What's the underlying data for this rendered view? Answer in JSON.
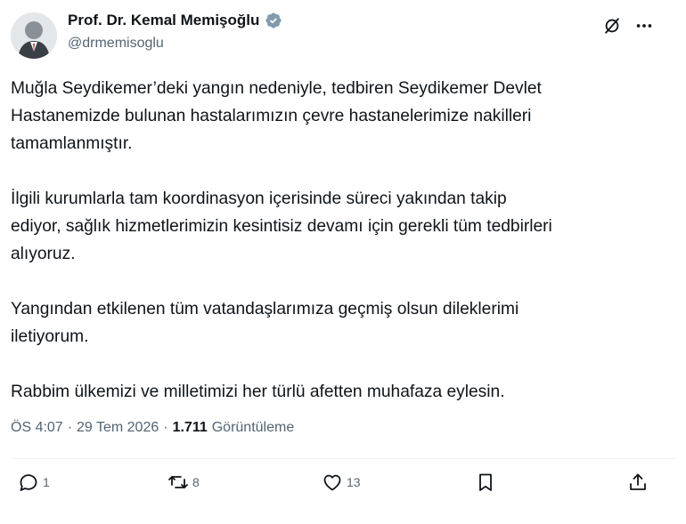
{
  "author": {
    "display_name": "Prof. Dr. Kemal Memişoğlu",
    "handle": "@drmemisoglu",
    "avatar_icon": "avatar-photo",
    "verified_icon": "verified-badge-icon"
  },
  "top_actions": {
    "grok_icon": "grok-icon",
    "more_icon": "more-icon"
  },
  "tweet": {
    "paragraphs": [
      "Muğla Seydikemer’deki yangın nedeniyle, tedbiren Seydikemer Devlet\nHastanemizde bulunan hastalarımızın çevre hastanelerimize nakilleri\ntamamlanmıştır.",
      "İlgili kurumlarla tam koordinasyon içerisinde süreci yakından takip\nediyor, sağlık hizmetlerimizin kesintisiz devamı için gerekli tüm tedbirleri\nalıyoruz.",
      "Yangından etkilenen tüm vatandaşlarımıza geçmiş olsun dileklerimi\niletiyorum.",
      "Rabbim ülkemizi ve milletimizi her türlü afetten muhafaza eylesin."
    ]
  },
  "meta": {
    "time": "ÖS 4:07",
    "separator": "·",
    "date": "29 Tem 2026",
    "views_count": "1.711",
    "views_label": "Görüntüleme"
  },
  "actions": {
    "reply_count": "1",
    "retweet_count": "8",
    "like_count": "13",
    "colors": {
      "icon": "#536471",
      "text": "#0f1419",
      "verified": "#829aab"
    }
  }
}
